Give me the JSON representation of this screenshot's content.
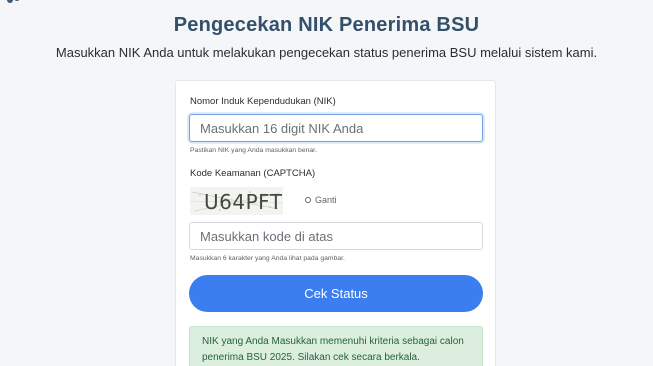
{
  "header": {
    "title": "Pengecekan NIK Penerima BSU",
    "subtitle": "Masukkan NIK Anda untuk melakukan pengecekan status penerima BSU melalui sistem kami."
  },
  "form": {
    "nik": {
      "label": "Nomor Induk Kependudukan (NIK)",
      "placeholder": "Masukkan 16 digit NIK Anda",
      "hint": "Pastikan NIK yang Anda masukkan benar."
    },
    "captcha": {
      "label": "Kode Keamanan (CAPTCHA)",
      "code": "U64PFT",
      "refresh_label": "Ganti",
      "placeholder": "Masukkan kode di atas",
      "hint": "Masukkan 6 karakter yang Anda lihat pada gambar."
    },
    "submit_label": "Cek Status",
    "result_message": "NIK yang Anda Masukkan memenuhi kriteria sebagai calon penerima BSU 2025. Silakan cek secara berkala."
  },
  "colors": {
    "accent": "#3b7ef0",
    "title": "#34506a",
    "success_bg": "#dcefdf",
    "success_text": "#25623a"
  }
}
